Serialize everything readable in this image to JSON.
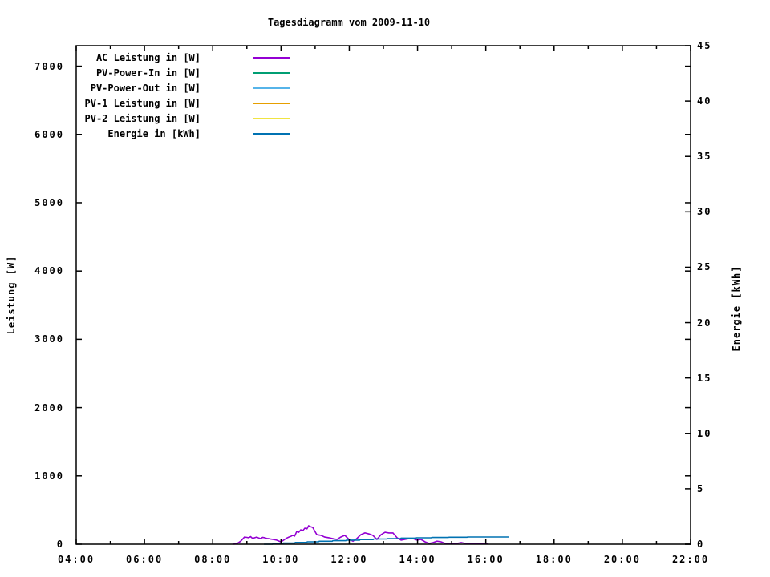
{
  "page": {
    "background": "#ffffff"
  },
  "chart_data": {
    "type": "line",
    "title": "Tagesdiagramm vom 2009-11-10",
    "ylabel": "Leistung [W]",
    "y2label": "Energie [kWh]",
    "grid": false,
    "legend_position": "top-left-inside",
    "x_axis": {
      "unit": "time",
      "min_hours": 4,
      "max_hours": 22,
      "major_tick_hours": [
        4,
        6,
        8,
        10,
        12,
        14,
        16,
        18,
        20,
        22
      ],
      "major_tick_labels": [
        "04:00",
        "06:00",
        "08:00",
        "10:00",
        "12:00",
        "14:00",
        "16:00",
        "18:00",
        "20:00",
        "22:00"
      ],
      "minor_tick_hours": [
        5,
        7,
        9,
        11,
        13,
        15,
        17,
        19,
        21
      ]
    },
    "y_axis": {
      "label": "Leistung [W]",
      "min": 0,
      "max": 7300,
      "tick_values": [
        0,
        1000,
        2000,
        3000,
        4000,
        5000,
        6000,
        7000
      ],
      "tick_labels": [
        "0",
        "1000",
        "2000",
        "3000",
        "4000",
        "5000",
        "6000",
        "7000"
      ]
    },
    "y2_axis": {
      "label": "Energie [kWh]",
      "min": 0,
      "max": 45,
      "tick_values": [
        0,
        5,
        10,
        15,
        20,
        25,
        30,
        35,
        40,
        45
      ],
      "tick_labels": [
        "0",
        "5",
        "10",
        "15",
        "20",
        "25",
        "30",
        "35",
        "40",
        "45"
      ]
    },
    "series": [
      {
        "name": "PV-Power-In in [W]",
        "color": "#009e73",
        "axis": "left",
        "width": 1,
        "points": [
          [
            8.58,
            0
          ],
          [
            16.67,
            0
          ]
        ]
      },
      {
        "name": "PV-Power-Out in [W]",
        "color": "#56b4e9",
        "axis": "left",
        "width": 1,
        "points": [
          [
            8.58,
            0
          ],
          [
            16.67,
            0
          ]
        ]
      },
      {
        "name": "PV-1 Leistung in [W]",
        "color": "#e69f00",
        "axis": "left",
        "width": 1,
        "points": [
          [
            8.58,
            0
          ],
          [
            16.67,
            0
          ]
        ]
      },
      {
        "name": "PV-2 Leistung in [W]",
        "color": "#f0e442",
        "axis": "left",
        "width": 1,
        "points": [
          [
            8.58,
            0
          ],
          [
            16.67,
            0
          ]
        ]
      },
      {
        "name": "AC Leistung in [W]",
        "color": "#9400d3",
        "axis": "left",
        "width": 1.6,
        "points": [
          [
            8.58,
            0
          ],
          [
            8.7,
            5
          ],
          [
            8.82,
            45
          ],
          [
            8.93,
            105
          ],
          [
            9.0,
            100
          ],
          [
            9.05,
            95
          ],
          [
            9.11,
            110
          ],
          [
            9.17,
            85
          ],
          [
            9.23,
            95
          ],
          [
            9.29,
            105
          ],
          [
            9.35,
            90
          ],
          [
            9.4,
            82
          ],
          [
            9.46,
            100
          ],
          [
            9.52,
            95
          ],
          [
            9.58,
            85
          ],
          [
            9.64,
            82
          ],
          [
            9.7,
            75
          ],
          [
            9.76,
            70
          ],
          [
            9.87,
            60
          ],
          [
            9.99,
            35
          ],
          [
            10.05,
            50
          ],
          [
            10.11,
            70
          ],
          [
            10.17,
            90
          ],
          [
            10.23,
            105
          ],
          [
            10.29,
            115
          ],
          [
            10.34,
            130
          ],
          [
            10.4,
            120
          ],
          [
            10.46,
            185
          ],
          [
            10.52,
            175
          ],
          [
            10.58,
            210
          ],
          [
            10.64,
            200
          ],
          [
            10.7,
            235
          ],
          [
            10.76,
            225
          ],
          [
            10.81,
            270
          ],
          [
            10.87,
            255
          ],
          [
            10.93,
            245
          ],
          [
            10.99,
            190
          ],
          [
            11.05,
            140
          ],
          [
            11.17,
            130
          ],
          [
            11.28,
            105
          ],
          [
            11.4,
            95
          ],
          [
            11.52,
            82
          ],
          [
            11.64,
            70
          ],
          [
            11.75,
            105
          ],
          [
            11.87,
            130
          ],
          [
            11.93,
            100
          ],
          [
            11.99,
            70
          ],
          [
            12.11,
            45
          ],
          [
            12.22,
            82
          ],
          [
            12.34,
            140
          ],
          [
            12.46,
            165
          ],
          [
            12.58,
            150
          ],
          [
            12.69,
            130
          ],
          [
            12.81,
            70
          ],
          [
            12.93,
            140
          ],
          [
            13.05,
            175
          ],
          [
            13.16,
            165
          ],
          [
            13.28,
            165
          ],
          [
            13.4,
            95
          ],
          [
            13.52,
            60
          ],
          [
            13.63,
            70
          ],
          [
            13.75,
            82
          ],
          [
            13.87,
            82
          ],
          [
            13.99,
            60
          ],
          [
            14.1,
            70
          ],
          [
            14.22,
            35
          ],
          [
            14.34,
            12
          ],
          [
            14.46,
            25
          ],
          [
            14.57,
            45
          ],
          [
            14.69,
            35
          ],
          [
            14.81,
            12
          ],
          [
            14.93,
            5
          ],
          [
            15.04,
            8
          ],
          [
            15.16,
            12
          ],
          [
            15.28,
            25
          ],
          [
            15.4,
            12
          ],
          [
            15.51,
            8
          ],
          [
            15.75,
            8
          ],
          [
            15.98,
            8
          ],
          [
            16.08,
            8
          ]
        ]
      },
      {
        "name": "Energie in [kWh]",
        "color": "#0072b2",
        "axis": "right",
        "width": 1.6,
        "points": [
          [
            9.5,
            0
          ],
          [
            9.75,
            0
          ],
          [
            9.77,
            0.05
          ],
          [
            10.05,
            0.05
          ],
          [
            10.07,
            0.1
          ],
          [
            10.4,
            0.1
          ],
          [
            10.42,
            0.16
          ],
          [
            10.75,
            0.16
          ],
          [
            10.77,
            0.22
          ],
          [
            11.1,
            0.22
          ],
          [
            11.12,
            0.27
          ],
          [
            11.5,
            0.27
          ],
          [
            11.52,
            0.32
          ],
          [
            11.9,
            0.32
          ],
          [
            11.92,
            0.37
          ],
          [
            12.3,
            0.37
          ],
          [
            12.32,
            0.42
          ],
          [
            12.7,
            0.42
          ],
          [
            12.72,
            0.47
          ],
          [
            13.1,
            0.47
          ],
          [
            13.12,
            0.51
          ],
          [
            13.5,
            0.51
          ],
          [
            13.52,
            0.55
          ],
          [
            13.95,
            0.55
          ],
          [
            13.97,
            0.58
          ],
          [
            14.4,
            0.58
          ],
          [
            14.42,
            0.61
          ],
          [
            14.9,
            0.61
          ],
          [
            14.92,
            0.63
          ],
          [
            15.45,
            0.63
          ],
          [
            15.47,
            0.65
          ],
          [
            16.67,
            0.65
          ]
        ]
      }
    ],
    "legend_order": [
      "AC Leistung in [W]",
      "PV-Power-In in [W]",
      "PV-Power-Out in [W]",
      "PV-1 Leistung in [W]",
      "PV-2 Leistung in [W]",
      "Energie in [kWh]"
    ]
  }
}
